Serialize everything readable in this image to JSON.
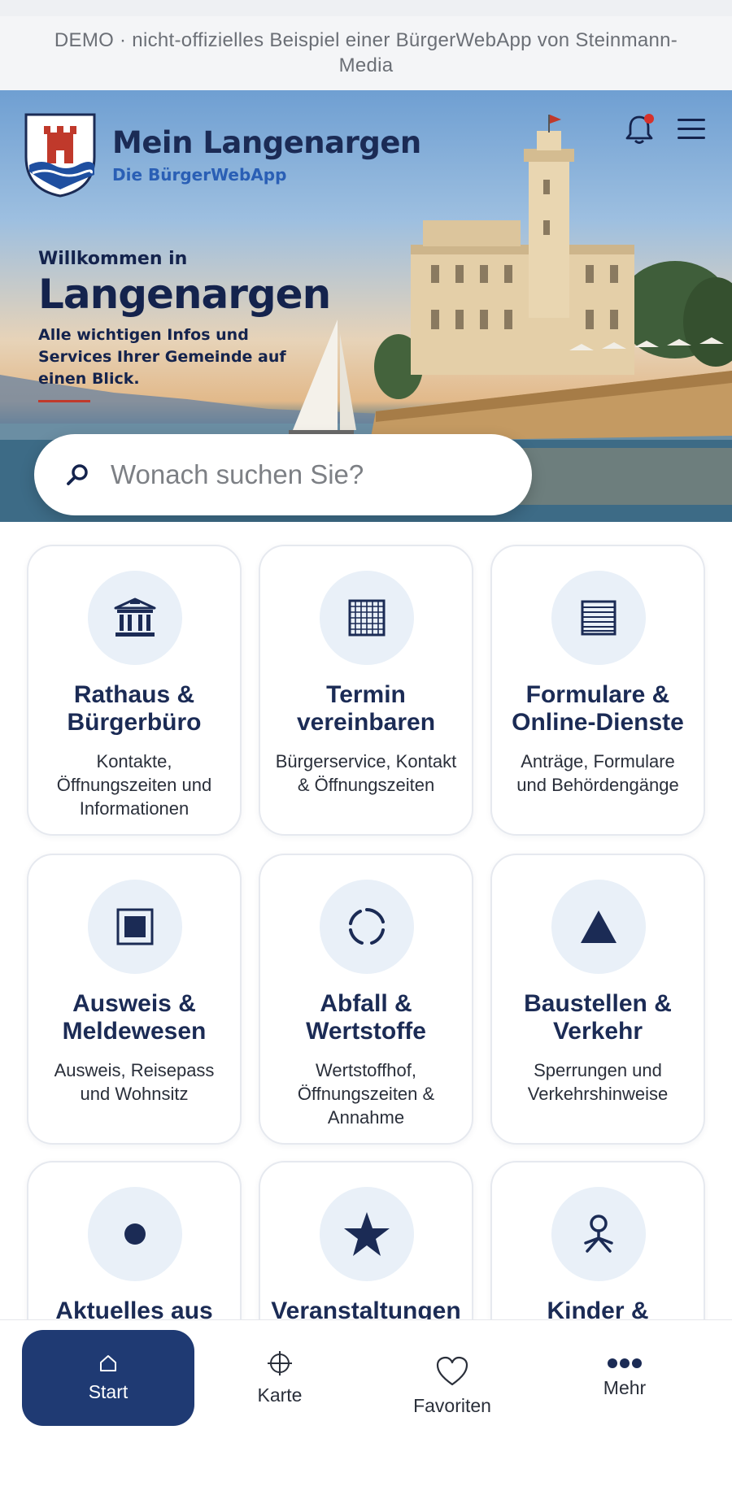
{
  "demo_banner": "DEMO · nicht-offizielles Beispiel einer BürgerWebApp von Steinmann-Media",
  "header": {
    "title": "Mein Langenargen",
    "subtitle": "Die BürgerWebApp",
    "bell_icon": "bell-icon",
    "menu_icon": "hamburger-menu-icon",
    "has_notification": true
  },
  "hero": {
    "welcome_line": "Willkommen in",
    "town": "Langenargen",
    "tagline": "Alle wichtigen Infos und Services Ihrer Gemeinde auf einen Blick."
  },
  "search": {
    "placeholder": "Wonach suchen Sie?",
    "icon": "search-icon"
  },
  "tiles": [
    {
      "icon": "town-hall-icon",
      "title": "Rathaus & Bürgerbüro",
      "desc": "Kontakte, Öffnungszeiten und Informationen"
    },
    {
      "icon": "calendar-grid-icon",
      "title": "Termin vereinbaren",
      "desc": "Bürgerservice, Kontakt & Öffnungszeiten"
    },
    {
      "icon": "forms-list-icon",
      "title": "Formulare & Online-Dienste",
      "desc": "Anträge, Formulare und Behördengänge"
    },
    {
      "icon": "id-card-icon",
      "title": "Ausweis & Meldewesen",
      "desc": "Ausweis, Reisepass und Wohnsitz"
    },
    {
      "icon": "recycle-icon",
      "title": "Abfall & Wertstoffe",
      "desc": "Wertstoffhof, Öffnungszeiten & Annahme"
    },
    {
      "icon": "warning-triangle-icon",
      "title": "Baustellen & Verkehr",
      "desc": "Sperrungen und Verkehrshinweise"
    },
    {
      "icon": "news-dot-icon",
      "title": "Aktuelles aus",
      "desc": ""
    },
    {
      "icon": "star-icon",
      "title": "Veranstaltungen",
      "desc": ""
    },
    {
      "icon": "child-icon",
      "title": "Kinder &",
      "desc": ""
    }
  ],
  "nav": [
    {
      "icon": "home-icon",
      "label": "Start",
      "active": true
    },
    {
      "icon": "map-crosshair-icon",
      "label": "Karte",
      "active": false
    },
    {
      "icon": "heart-icon",
      "label": "Favoriten",
      "active": false
    },
    {
      "icon": "more-dots-icon",
      "label": "Mehr",
      "active": false
    }
  ],
  "colors": {
    "brand_navy": "#1b2b55",
    "accent_blue": "#2a5fb5",
    "nav_active": "#1f3a73",
    "notification": "#d6322c",
    "icon_circle_bg": "#e9f0f8"
  }
}
